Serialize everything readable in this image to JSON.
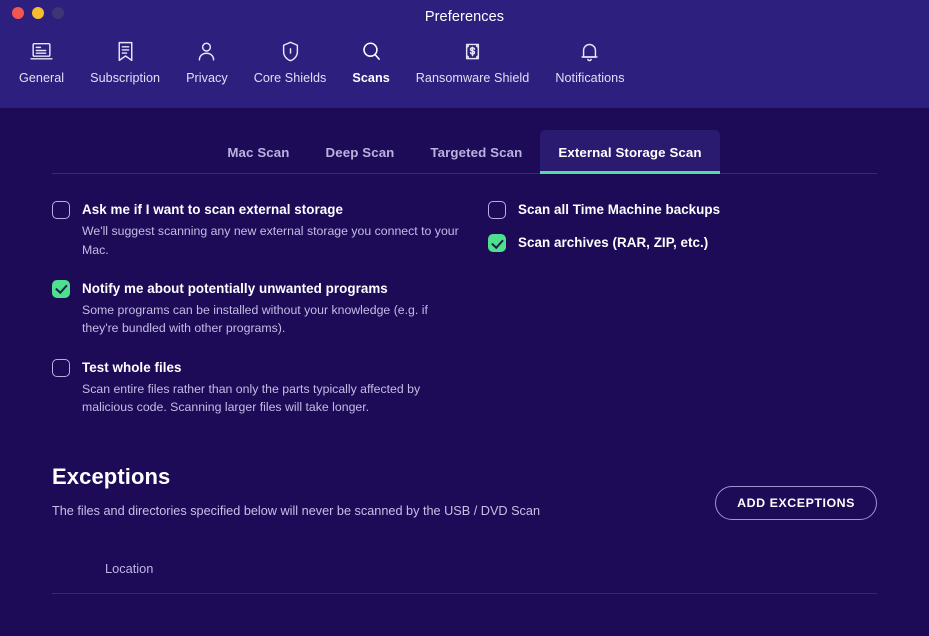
{
  "window": {
    "title": "Preferences",
    "controls": [
      {
        "name": "close",
        "color": "#f4564f"
      },
      {
        "name": "minimize",
        "color": "#f7bd2e"
      },
      {
        "name": "zoom",
        "color": "#3e3476"
      }
    ]
  },
  "toolbar": {
    "items": [
      {
        "label": "General",
        "icon": "laptop-document-icon",
        "active": false
      },
      {
        "label": "Subscription",
        "icon": "bookmark-list-icon",
        "active": false
      },
      {
        "label": "Privacy",
        "icon": "person-icon",
        "active": false
      },
      {
        "label": "Core Shields",
        "icon": "shield-icon",
        "active": false
      },
      {
        "label": "Scans",
        "icon": "magnifier-icon",
        "active": true
      },
      {
        "label": "Ransomware Shield",
        "icon": "money-lock-icon",
        "active": false
      },
      {
        "label": "Notifications",
        "icon": "bell-icon",
        "active": false
      }
    ]
  },
  "subtabs": [
    {
      "label": "Mac Scan",
      "active": false
    },
    {
      "label": "Deep Scan",
      "active": false
    },
    {
      "label": "Targeted Scan",
      "active": false
    },
    {
      "label": "External Storage Scan",
      "active": true
    }
  ],
  "options": {
    "left": [
      {
        "title": "Ask me if I want to scan external storage",
        "desc": "We'll suggest scanning any new external storage you connect to your Mac.",
        "checked": false
      },
      {
        "title": "Notify me about potentially unwanted programs",
        "desc": "Some programs can be installed without your knowledge (e.g. if they're bundled with other programs).",
        "checked": true
      },
      {
        "title": "Test whole files",
        "desc": "Scan entire files rather than only the parts typically affected by malicious code. Scanning larger files will take longer.",
        "checked": false
      }
    ],
    "right": [
      {
        "title": "Scan all Time Machine backups",
        "desc": "",
        "checked": false
      },
      {
        "title": "Scan archives (RAR, ZIP, etc.)",
        "desc": "",
        "checked": true
      }
    ]
  },
  "exceptions": {
    "title": "Exceptions",
    "description": "The files and directories specified below will never be scanned by the USB / DVD Scan",
    "add_button": "ADD EXCEPTIONS",
    "columns": [
      "Location"
    ],
    "rows": []
  },
  "colors": {
    "header_bg": "#2d1f7e",
    "content_bg": "#1d0b58",
    "accent_green": "#4fe0a0",
    "active_tab_bg": "#2a1a70",
    "muted_text": "#c3bce4"
  }
}
